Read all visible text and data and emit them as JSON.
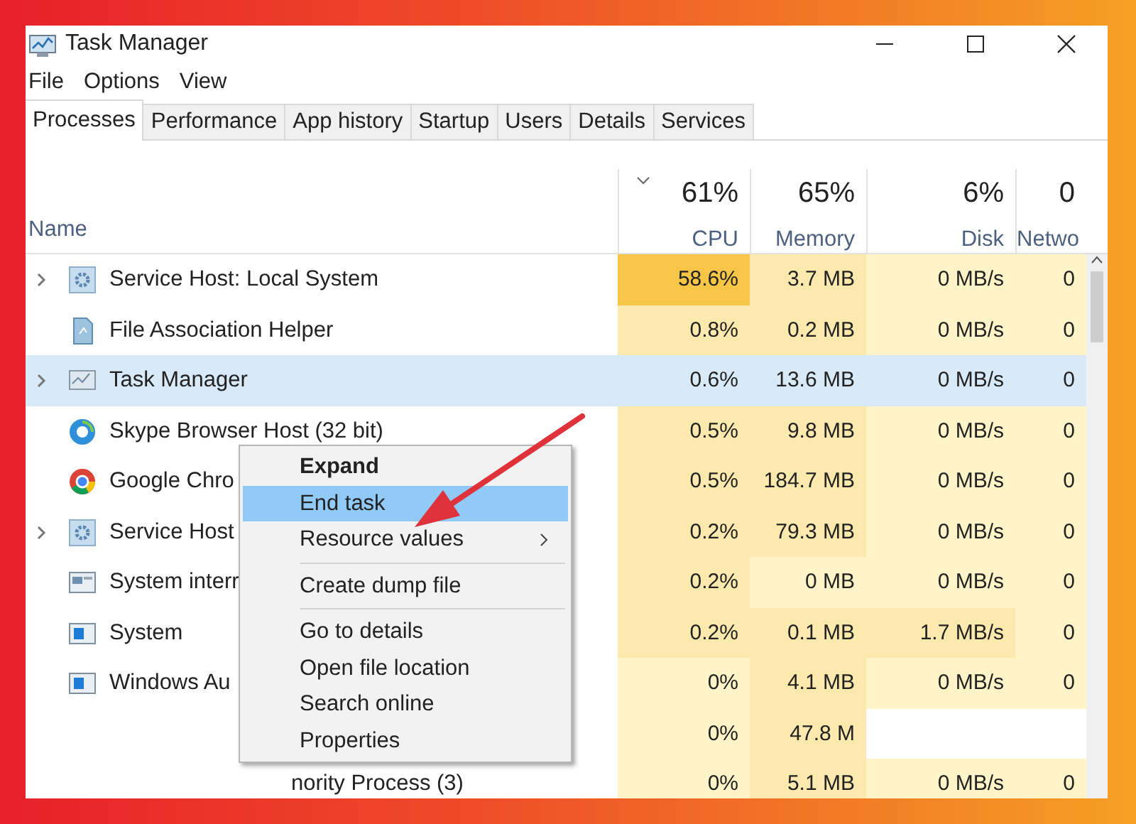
{
  "window": {
    "title": "Task Manager"
  },
  "menu": [
    "File",
    "Options",
    "View"
  ],
  "tabs": [
    {
      "label": "Processes",
      "selected": true
    },
    {
      "label": "Performance",
      "selected": false
    },
    {
      "label": "App history",
      "selected": false
    },
    {
      "label": "Startup",
      "selected": false
    },
    {
      "label": "Users",
      "selected": false
    },
    {
      "label": "Details",
      "selected": false
    },
    {
      "label": "Services",
      "selected": false
    }
  ],
  "columns": [
    {
      "label": "Name"
    },
    {
      "percent": "61%",
      "label": "CPU",
      "sorted": true
    },
    {
      "percent": "65%",
      "label": "Memory",
      "sorted": false
    },
    {
      "percent": "6%",
      "label": "Disk",
      "sorted": false
    },
    {
      "percent": "0",
      "label": "Netwo",
      "sorted": false
    }
  ],
  "rows": [
    {
      "name": "Service Host: Local System",
      "expandable": true,
      "selected": false,
      "cells": [
        {
          "text": "58.6%",
          "color": "#f8c646"
        },
        {
          "text": "3.7 MB",
          "color": "#fce9ad"
        },
        {
          "text": "0 MB/s",
          "color": "#fff4c8"
        },
        {
          "text": "0",
          "color": "#fff4c8"
        }
      ]
    },
    {
      "name": "File Association Helper",
      "expandable": false,
      "selected": false,
      "cells": [
        {
          "text": "0.8%",
          "color": "#fce9ad"
        },
        {
          "text": "0.2 MB",
          "color": "#fce9ad"
        },
        {
          "text": "0 MB/s",
          "color": "#fff4c8"
        },
        {
          "text": "0",
          "color": "#fff4c8"
        }
      ]
    },
    {
      "name": "Task Manager",
      "expandable": true,
      "selected": true,
      "cells": [
        {
          "text": "0.6%"
        },
        {
          "text": "13.6 MB"
        },
        {
          "text": "0 MB/s"
        },
        {
          "text": "0"
        }
      ]
    },
    {
      "name": "Skype Browser Host (32 bit)",
      "expandable": false,
      "selected": false,
      "cells": [
        {
          "text": "0.5%",
          "color": "#fce9ad"
        },
        {
          "text": "9.8 MB",
          "color": "#fce9ad"
        },
        {
          "text": "0 MB/s",
          "color": "#fff4c8"
        },
        {
          "text": "0",
          "color": "#fff4c8"
        }
      ]
    },
    {
      "name": "Google Chro",
      "expandable": false,
      "selected": false,
      "cells": [
        {
          "text": "0.5%",
          "color": "#fce9ad"
        },
        {
          "text": "184.7 MB",
          "color": "#fce9ad"
        },
        {
          "text": "0 MB/s",
          "color": "#fff4c8"
        },
        {
          "text": "0",
          "color": "#fff4c8"
        }
      ]
    },
    {
      "name": "Service Host",
      "expandable": true,
      "selected": false,
      "cells": [
        {
          "text": "0.2%",
          "color": "#fce9ad"
        },
        {
          "text": "79.3 MB",
          "color": "#fce9ad"
        },
        {
          "text": "0 MB/s",
          "color": "#fff4c8"
        },
        {
          "text": "0",
          "color": "#fff4c8"
        }
      ]
    },
    {
      "name": "System interr",
      "expandable": false,
      "selected": false,
      "cells": [
        {
          "text": "0.2%",
          "color": "#fce9ad"
        },
        {
          "text": "0 MB",
          "color": "#fff4c8"
        },
        {
          "text": "0 MB/s",
          "color": "#fff4c8"
        },
        {
          "text": "0",
          "color": "#fff4c8"
        }
      ]
    },
    {
      "name": "System",
      "expandable": false,
      "selected": false,
      "cells": [
        {
          "text": "0.2%",
          "color": "#fce9ad"
        },
        {
          "text": "0.1 MB",
          "color": "#fce9ad"
        },
        {
          "text": "1.7 MB/s",
          "color": "#fce9ad"
        },
        {
          "text": "0",
          "color": "#fff4c8"
        }
      ]
    },
    {
      "name": "Windows Au",
      "expandable": false,
      "selected": false,
      "cells": [
        {
          "text": "0%",
          "color": "#fff4c8"
        },
        {
          "text": "4.1 MB",
          "color": "#fce9ad"
        },
        {
          "text": "0 MB/s",
          "color": "#fff4c8"
        },
        {
          "text": "0",
          "color": "#fff4c8"
        }
      ]
    },
    {
      "expandable": false,
      "selected": false,
      "cells": [
        {
          "text": "0%",
          "color": "#fff4c8"
        },
        {
          "text": "47.8 M",
          "color": "#fce9ad"
        }
      ]
    },
    {
      "name": "nority Process (3)",
      "expandable": false,
      "selected": false,
      "cells": [
        {
          "text": "0%",
          "color": "#fff4c8"
        },
        {
          "text": "5.1 MB",
          "color": "#fce9ad"
        },
        {
          "text": "0 MB/s",
          "color": "#fff4c8"
        },
        {
          "text": "0",
          "color": "#fff4c8"
        }
      ]
    }
  ],
  "context_menu": [
    [
      {
        "label": "Expand",
        "default": true,
        "selected": false,
        "submenu": false
      },
      {
        "label": "End task",
        "default": false,
        "selected": true,
        "submenu": false
      },
      {
        "label": "Resource values",
        "default": false,
        "selected": false,
        "submenu": true
      }
    ],
    [
      {
        "label": "Create dump file",
        "default": false,
        "selected": false,
        "submenu": false
      }
    ],
    [
      {
        "label": "Go to details",
        "default": false,
        "selected": false,
        "submenu": false
      },
      {
        "label": "Open file location",
        "default": false,
        "selected": false,
        "submenu": false
      },
      {
        "label": "Search online",
        "default": false,
        "selected": false,
        "submenu": false
      },
      {
        "label": "Properties",
        "default": false,
        "selected": false,
        "submenu": false
      }
    ]
  ]
}
